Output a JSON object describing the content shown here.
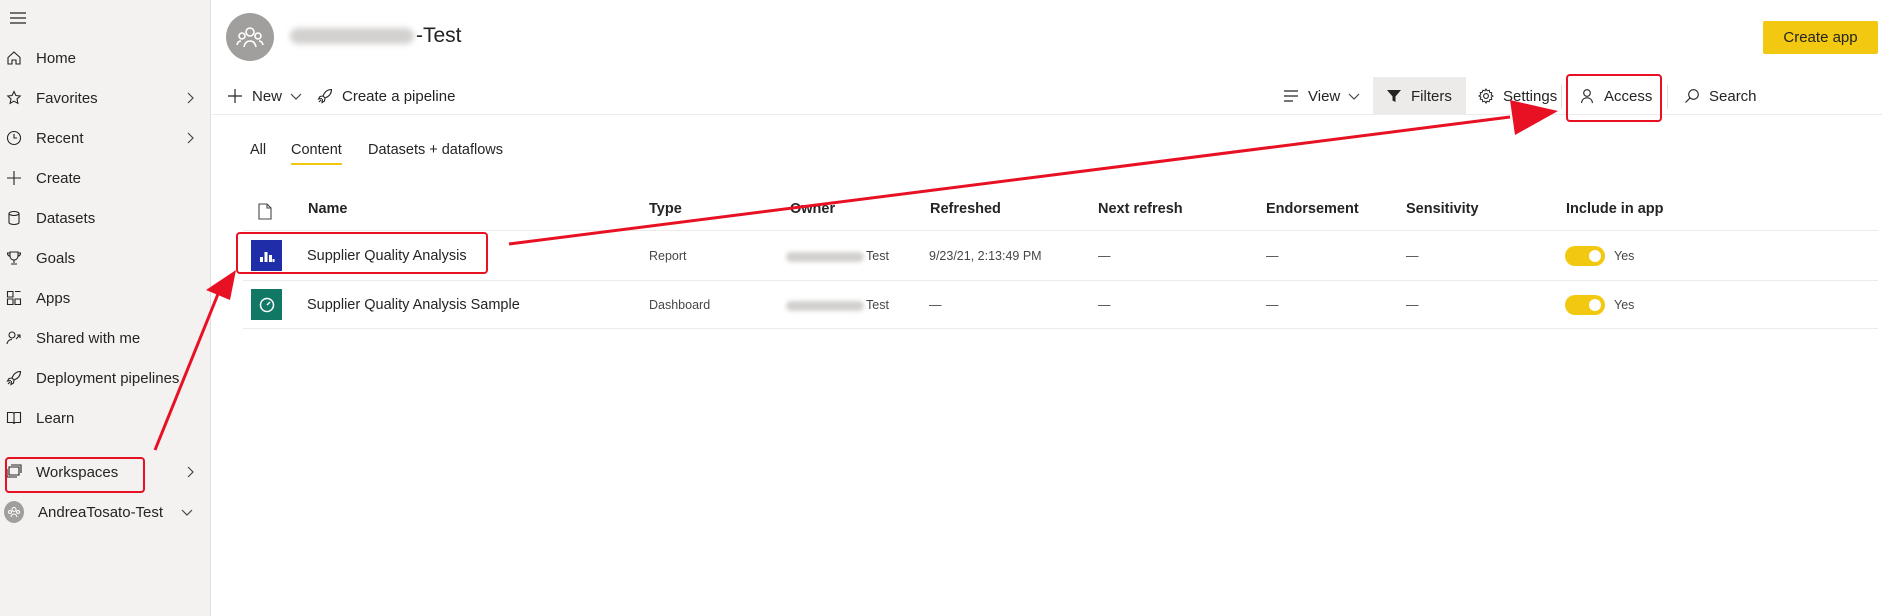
{
  "sidebar": {
    "items": [
      {
        "label": "Home",
        "icon": "home-icon"
      },
      {
        "label": "Favorites",
        "icon": "star-icon",
        "expandable": true
      },
      {
        "label": "Recent",
        "icon": "clock-icon",
        "expandable": true
      },
      {
        "label": "Create",
        "icon": "plus-icon"
      },
      {
        "label": "Datasets",
        "icon": "database-icon"
      },
      {
        "label": "Goals",
        "icon": "trophy-icon"
      },
      {
        "label": "Apps",
        "icon": "apps-icon"
      },
      {
        "label": "Shared with me",
        "icon": "shared-icon"
      },
      {
        "label": "Deployment pipelines",
        "icon": "rocket-icon"
      },
      {
        "label": "Learn",
        "icon": "book-icon"
      },
      {
        "label": "Workspaces",
        "icon": "workspaces-icon",
        "expandable": true
      },
      {
        "label": "AndreaTosato-Test",
        "icon": "workspace-avatar-icon",
        "expandable": true
      }
    ]
  },
  "header": {
    "title_suffix": "-Test",
    "create_app_label": "Create app"
  },
  "toolbar": {
    "new_label": "New",
    "pipeline_label": "Create a pipeline",
    "view_label": "View",
    "filters_label": "Filters",
    "settings_label": "Settings",
    "access_label": "Access",
    "search_label": "Search"
  },
  "tabs": [
    {
      "label": "All",
      "active": false
    },
    {
      "label": "Content",
      "active": true
    },
    {
      "label": "Datasets + dataflows",
      "active": false
    }
  ],
  "table": {
    "columns": [
      "Name",
      "Type",
      "Owner",
      "Refreshed",
      "Next refresh",
      "Endorsement",
      "Sensitivity",
      "Include in app"
    ],
    "rows": [
      {
        "name": "Supplier Quality Analysis",
        "icon": "report-icon",
        "type": "Report",
        "owner_suffix": "Test",
        "refreshed": "9/23/21, 2:13:49 PM",
        "next_refresh": "—",
        "endorsement": "—",
        "sensitivity": "—",
        "include": "Yes",
        "include_on": true
      },
      {
        "name": "Supplier Quality Analysis Sample",
        "icon": "dashboard-icon",
        "type": "Dashboard",
        "owner_suffix": "Test",
        "refreshed": "—",
        "next_refresh": "—",
        "endorsement": "—",
        "sensitivity": "—",
        "include": "Yes",
        "include_on": true
      }
    ]
  },
  "colors": {
    "accent": "#f2c811",
    "annotation": "#e81123",
    "report_icon_bg": "#1f2ea8",
    "dashboard_icon_bg": "#117865",
    "sidebar_bg": "#f3f2f1"
  }
}
